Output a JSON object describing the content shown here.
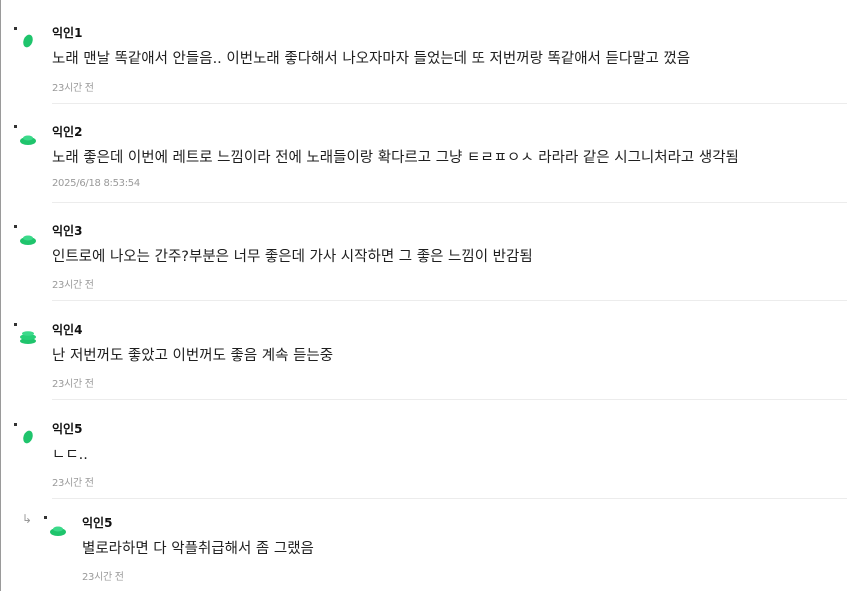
{
  "comments": [
    {
      "author": "익인1",
      "text": "노래 맨날 똑같애서 안들음.. 이번노래 좋다해서 나오자마자 들었는데 또 저번꺼랑 똑같애서 듣다말고 껐음",
      "time": "23시간 전"
    },
    {
      "author": "익인2",
      "text": "노래 좋은데 이번에 레트로 느낌이라 전에 노래들이랑 확다르고 그냥 ㅌㄹㅍㅇㅅ 라라라 같은 시그니처라고 생각됨",
      "time": "2025/6/18 8:53:54"
    },
    {
      "author": "익인3",
      "text": "인트로에 나오는 간주?부분은 너무 좋은데 가사 시작하면 그 좋은 느낌이 반감됨",
      "time": "23시간 전"
    },
    {
      "author": "익인4",
      "text": "난 저번꺼도 좋았고 이번꺼도 좋음 계속 듣는중",
      "time": "23시간 전"
    },
    {
      "author": "익인5",
      "text": "ㄴㄷ..",
      "time": "23시간 전"
    }
  ],
  "reply": {
    "author": "익인5",
    "text": "별로라하면 다 악플취급해서 좀 그랬음",
    "time": "23시간 전",
    "arrow": "↳"
  },
  "colors": {
    "avatar": "#1fc46c",
    "text": "#1f1f1f",
    "muted": "#9a9a9a",
    "divider": "#ececec"
  }
}
